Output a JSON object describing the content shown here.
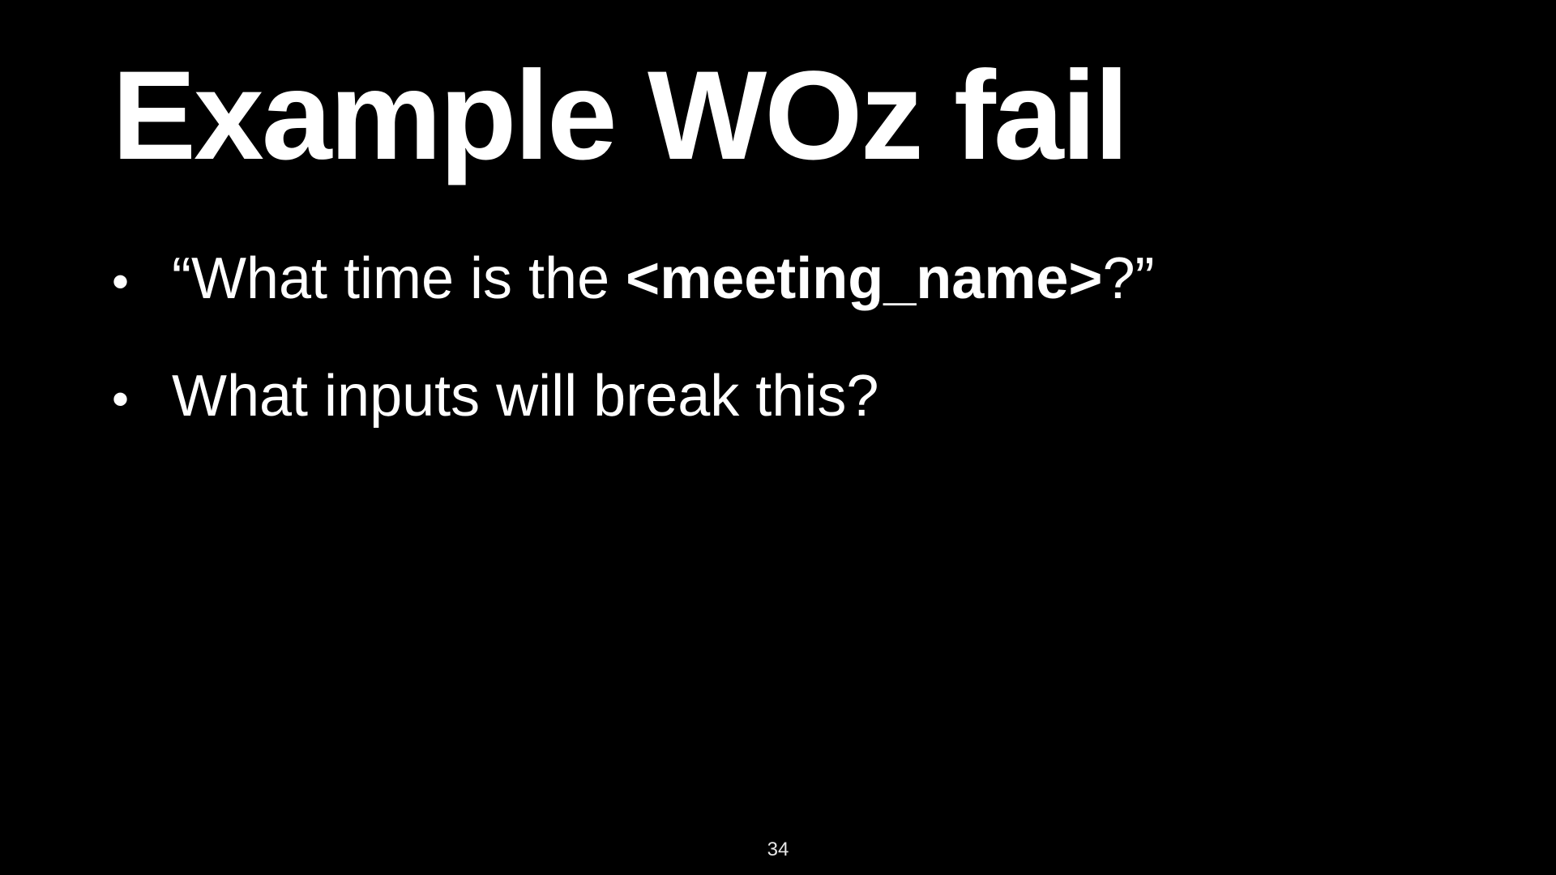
{
  "slide": {
    "title": "Example WOz fail",
    "bullets": [
      {
        "bullet_glyph": "•",
        "text_before": "“What time is the ",
        "text_bold": "<meeting_name>",
        "text_after": "?”"
      },
      {
        "bullet_glyph": "•",
        "text": "What inputs will break this?"
      }
    ],
    "page_number": "34"
  },
  "colors": {
    "background": "#000000",
    "text": "#ffffff"
  }
}
